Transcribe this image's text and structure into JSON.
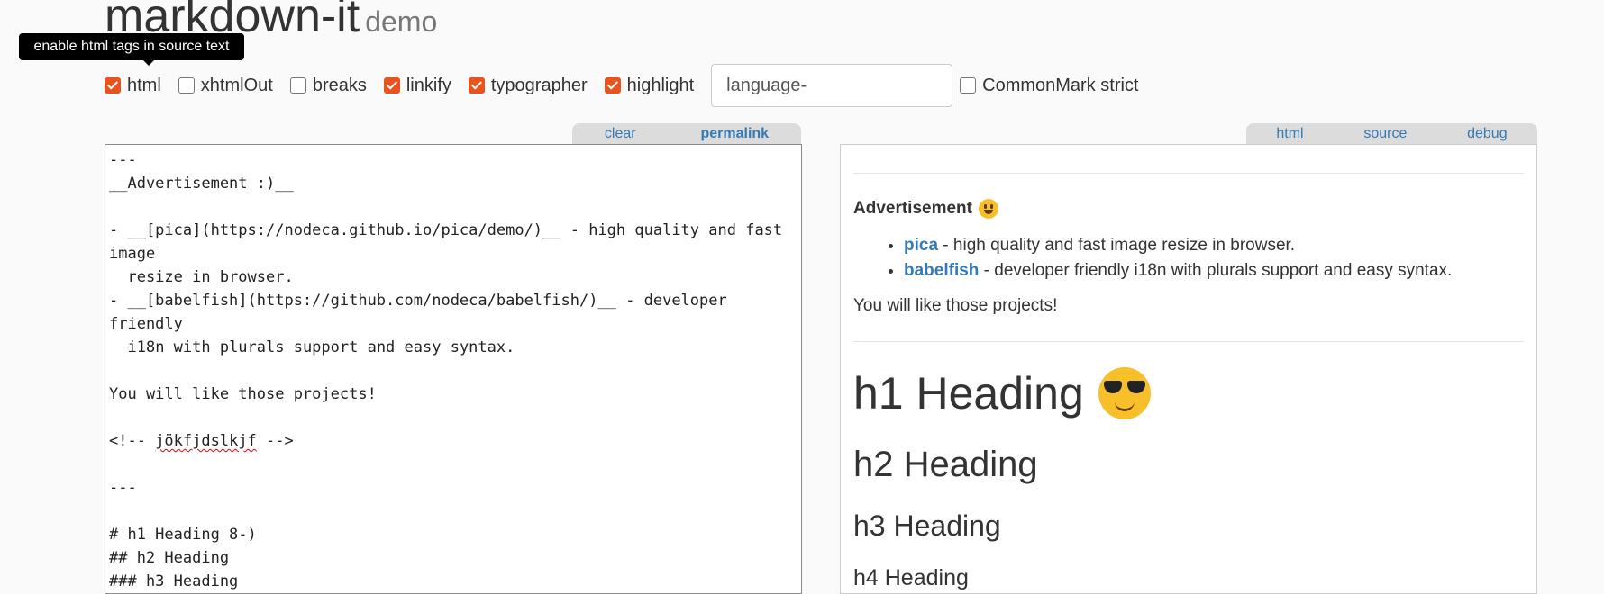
{
  "header": {
    "title": "markdown-it",
    "subtitle": "demo"
  },
  "tooltip": {
    "text": "enable html tags in source text"
  },
  "options": {
    "html": {
      "label": "html",
      "checked": true
    },
    "xhtmlOut": {
      "label": "xhtmlOut",
      "checked": false
    },
    "breaks": {
      "label": "breaks",
      "checked": false
    },
    "linkify": {
      "label": "linkify",
      "checked": true
    },
    "typographer": {
      "label": "typographer",
      "checked": true
    },
    "highlight": {
      "label": "highlight",
      "checked": true
    },
    "language_placeholder": "language-",
    "commonmark": {
      "label": "CommonMark strict",
      "checked": false
    }
  },
  "source_tabs": {
    "clear": "clear",
    "permalink": "permalink"
  },
  "result_tabs": {
    "html": "html",
    "source": "source",
    "debug": "debug"
  },
  "editor": {
    "lines": [
      "---",
      "__Advertisement :)__",
      "",
      "- __[pica](https://nodeca.github.io/pica/demo/)__ - high quality and fast image",
      "  resize in browser.",
      "- __[babelfish](https://github.com/nodeca/babelfish/)__ - developer friendly",
      "  i18n with plurals support and easy syntax.",
      "",
      "You will like those projects!",
      "",
      "<!-- ",
      "jökfjdslkjf",
      " -->",
      "",
      "---",
      "",
      "# h1 Heading 8-)",
      "## h2 Heading",
      "### h3 Heading"
    ]
  },
  "preview": {
    "advertisement": "Advertisement",
    "items": [
      {
        "link": "pica",
        "text": " - high quality and fast image resize in browser."
      },
      {
        "link": "babelfish",
        "text": " - developer friendly i18n with plurals support and easy syntax."
      }
    ],
    "paragraph": "You will like those projects!",
    "h1": "h1 Heading",
    "h2": "h2 Heading",
    "h3": "h3 Heading",
    "h4": "h4 Heading"
  },
  "colors": {
    "accent": "#e8541f",
    "link": "#337ab7",
    "tooltip_bg": "#000000"
  },
  "icons": {
    "smile": "smiley-emoji-icon",
    "cool": "sunglasses-emoji-icon"
  }
}
